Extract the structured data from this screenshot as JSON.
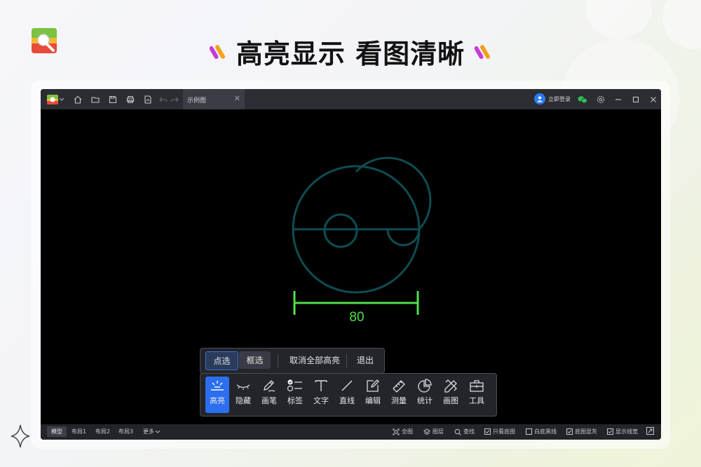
{
  "headline": "高亮显示 看图清晰",
  "app": {
    "tab_title": "示例图",
    "tab_close": "✕",
    "login_label": "立即登录"
  },
  "canvas": {
    "dimension_text": "80",
    "colors": {
      "geometry": "#0e4c52",
      "dimension": "#4fe04a"
    }
  },
  "popup": {
    "buttons": [
      {
        "label": "点选",
        "state": "active"
      },
      {
        "label": "框选",
        "state": "selected"
      },
      {
        "label": "取消全部高亮"
      },
      {
        "label": "退出"
      }
    ]
  },
  "toolbar": {
    "tools": [
      {
        "label": "高亮",
        "icon": "highlight-icon",
        "active": true
      },
      {
        "label": "隐藏",
        "icon": "eye-closed-icon"
      },
      {
        "label": "画笔",
        "icon": "pen-icon"
      },
      {
        "label": "标签",
        "icon": "tag-list-icon"
      },
      {
        "label": "文字",
        "icon": "text-icon"
      },
      {
        "label": "直线",
        "icon": "line-icon"
      },
      {
        "label": "编辑",
        "icon": "edit-icon"
      },
      {
        "label": "测量",
        "icon": "ruler-icon"
      },
      {
        "label": "统计",
        "icon": "pie-chart-icon"
      },
      {
        "label": "画图",
        "icon": "draw-icon"
      },
      {
        "label": "工具",
        "icon": "toolbox-icon"
      }
    ]
  },
  "statusbar": {
    "tabs": [
      "模型",
      "布局1",
      "布局2",
      "布局3",
      "更多"
    ],
    "right": {
      "fullview": "全图",
      "layers": "图层",
      "find": "查找",
      "only_base": "只看底图",
      "white_bg_black_line": "白底黑线",
      "base_gray": "底图显灰",
      "show_linewidth": "显示线宽"
    },
    "checkbox_states": {
      "only_base": true,
      "white_bg_black_line": false,
      "base_gray": true,
      "show_linewidth": true
    }
  },
  "accent_color": "#2b6ff0"
}
